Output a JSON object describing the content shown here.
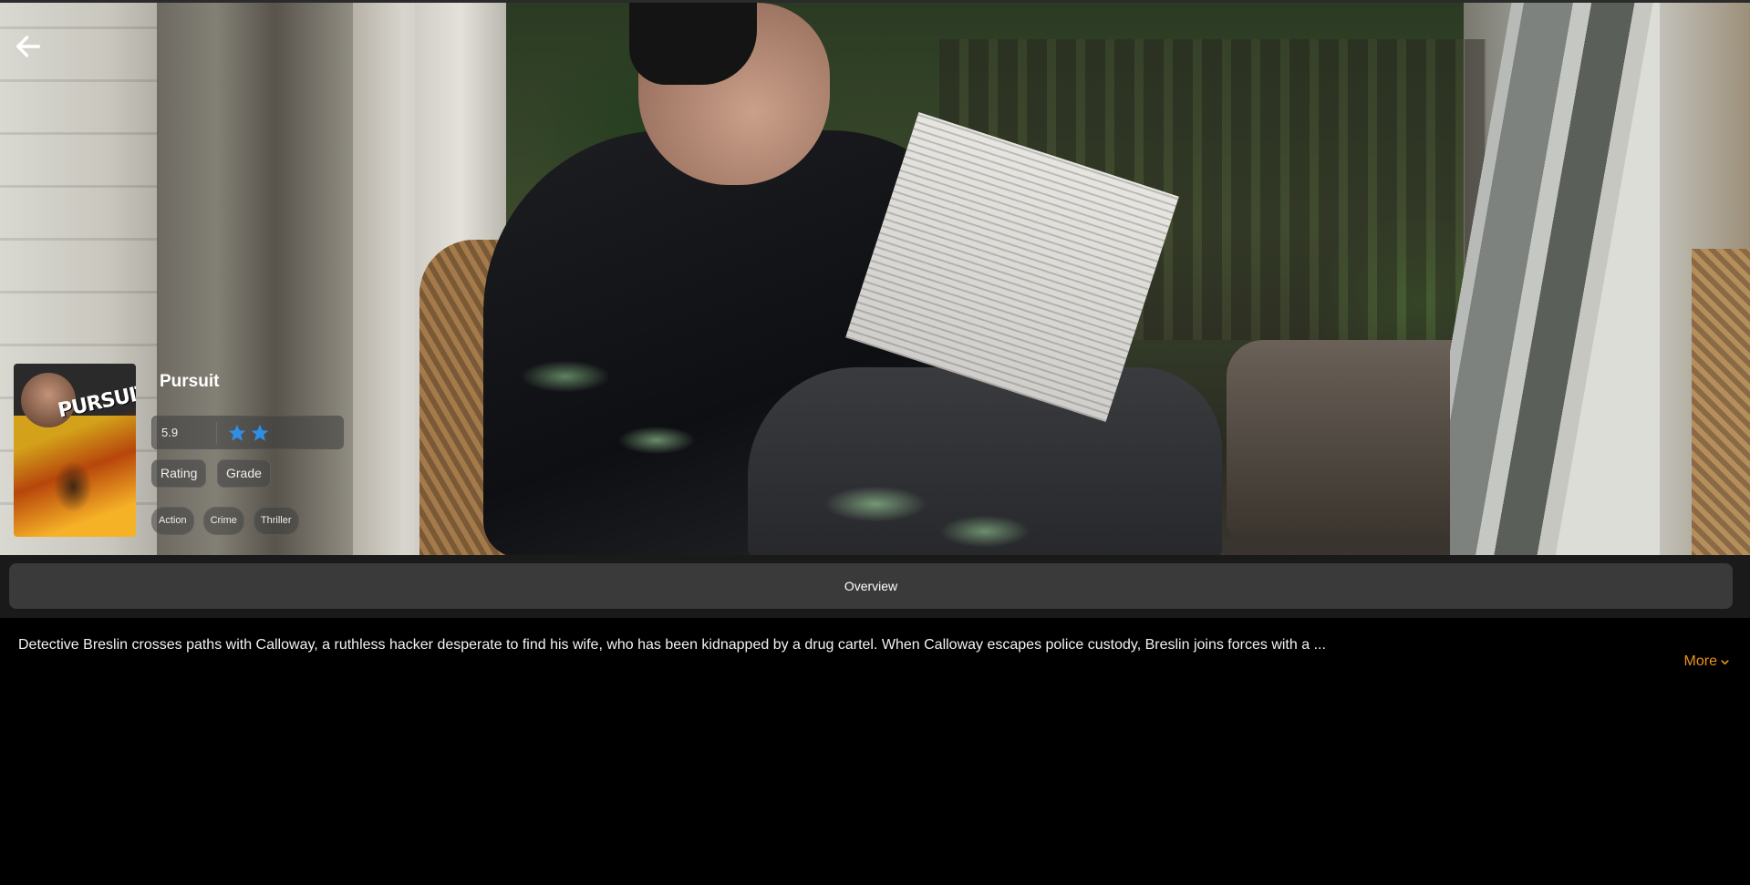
{
  "header": {
    "back_icon": "arrow-left-icon"
  },
  "movie": {
    "title": "Pursuit",
    "poster_title": "PURSUIT",
    "score": "5.9",
    "stars_shown": 2,
    "star_color": "#2f8fe8",
    "rating_label": "Rating",
    "grade_label": "Grade",
    "genres": [
      "Action",
      "Crime",
      "Thriller"
    ]
  },
  "tabs": {
    "overview_label": "Overview"
  },
  "overview": {
    "text": "Detective Breslin crosses paths with Calloway, a ruthless hacker desperate to find his wife, who has been kidnapped by a drug cartel. When Calloway escapes police custody, Breslin joins forces with a ...",
    "more_label": "More",
    "more_color": "#e8931d"
  }
}
